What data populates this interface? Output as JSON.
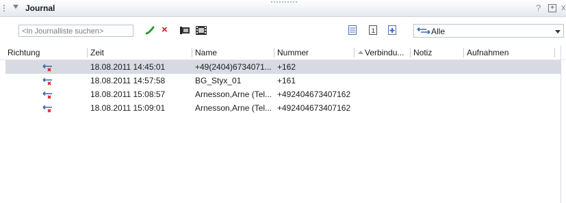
{
  "panel": {
    "title": "Journal",
    "help": "?",
    "maximize": "+",
    "close": "x"
  },
  "toolbar": {
    "search_placeholder": "<In Journalliste suchen>",
    "delete": "×",
    "filter_value": "Alle"
  },
  "icons": {
    "call": "phone-icon",
    "delete": "delete-icon",
    "video1": "film-icon",
    "video2": "film-icon",
    "view_list": "list-view-icon",
    "view_single": "single-view-icon",
    "view_add": "add-view-icon",
    "filter": "direction-filter-icon",
    "row_direction": "missed-incoming-call-icon"
  },
  "columns": {
    "richtung": "Richtung",
    "zeit": "Zeit",
    "name": "Name",
    "nummer": "Nummer",
    "verbindung": "Verbindu...",
    "notiz": "Notiz",
    "aufnahmen": "Aufnahmen"
  },
  "rows": [
    {
      "zeit": "18.08.2011 14:45:01",
      "name": "+49(2404)6734071...",
      "nummer": "+162",
      "selected": true
    },
    {
      "zeit": "18.08.2011 14:57:58",
      "name": "BG_Styx_01",
      "nummer": "+161",
      "selected": false
    },
    {
      "zeit": "18.08.2011 15:08:57",
      "name": "Arnesson,Arne (Tel...",
      "nummer": "+492404673407162",
      "selected": false
    },
    {
      "zeit": "18.08.2011 15:09:01",
      "name": "Arnesson,Arne (Tel...",
      "nummer": "+492404673407162",
      "selected": false
    }
  ],
  "colors": {
    "selection": "#d7dae1",
    "delete_red": "#d11919",
    "call_green": "#2e9b2e",
    "arrow_blue": "#3a66b5"
  }
}
